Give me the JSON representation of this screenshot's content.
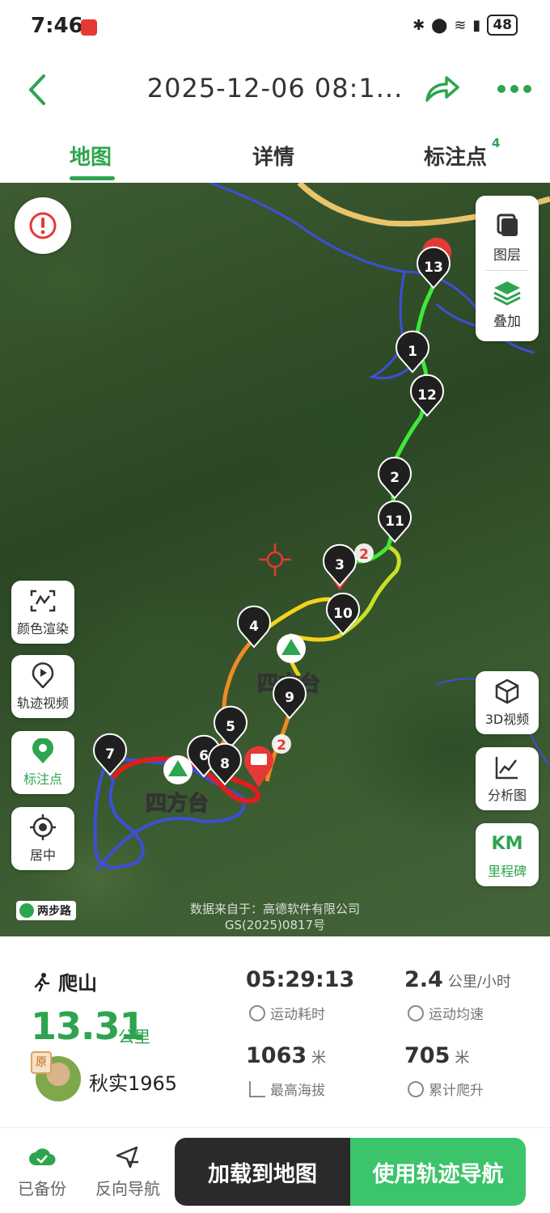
{
  "status_bar": {
    "time": "7:46",
    "battery": "48"
  },
  "header": {
    "title": "2025-12-06 08:1..."
  },
  "tabs": [
    {
      "label": "地图",
      "active": true
    },
    {
      "label": "详情",
      "active": false
    },
    {
      "label": "标注点",
      "active": false,
      "badge": "4"
    }
  ],
  "map": {
    "layers_label": "图层",
    "overlay_label": "叠加",
    "left_tools": [
      "颜色渲染",
      "轨迹视频",
      "标注点",
      "居中"
    ],
    "right_tools": [
      "3D视频",
      "分析图",
      "里程碑"
    ],
    "km_label": "KM",
    "place_label": "四方台",
    "credit_line1": "数据来自于：高德软件有限公司",
    "credit_line2": "GS(2025)0817号",
    "twostep_label": "两步路",
    "waypoints": [
      "1",
      "2",
      "3",
      "4",
      "5",
      "6",
      "7",
      "8",
      "9",
      "10",
      "11",
      "12",
      "13"
    ],
    "marker_badge": "2",
    "accent": "#2ea44f"
  },
  "stats": {
    "sport_type": "爬山",
    "distance": "13.31",
    "distance_unit": "公里",
    "badge": "原",
    "username": "秋实1965",
    "duration": "05:29:13",
    "duration_label": "运动耗时",
    "avg_speed": "2.4",
    "avg_speed_unit": "公里/小时",
    "avg_speed_label": "运动均速",
    "max_alt": "1063",
    "max_alt_unit": "米",
    "max_alt_label": "最高海拔",
    "climb": "705",
    "climb_unit": "米",
    "climb_label": "累计爬升"
  },
  "bottom_bar": {
    "backup_label": "已备份",
    "reverse_label": "反向导航",
    "load_label": "加载到地图",
    "nav_label": "使用轨迹导航"
  }
}
